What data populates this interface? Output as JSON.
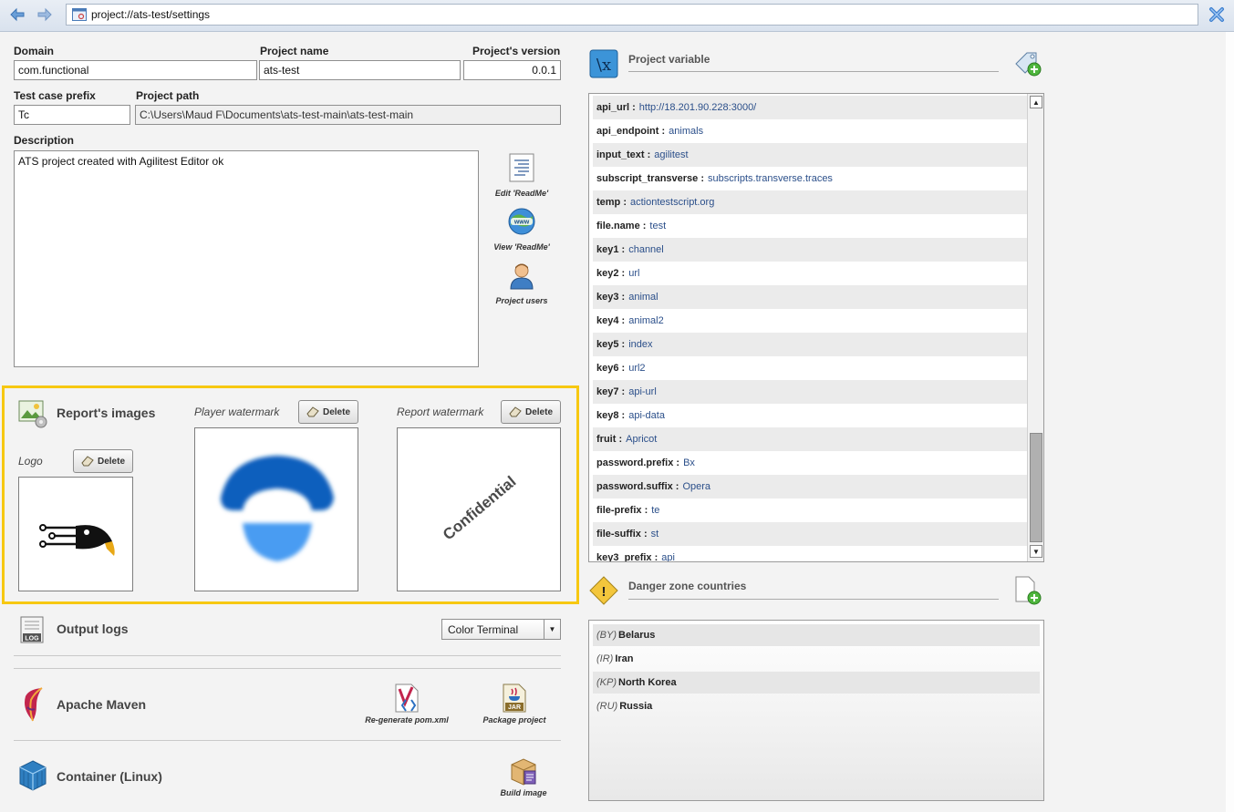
{
  "address_bar": {
    "url": "project://ats-test/settings"
  },
  "project": {
    "domain_label": "Domain",
    "domain_value": "com.functional",
    "name_label": "Project name",
    "name_value": "ats-test",
    "version_label": "Project's version",
    "version_value": "0.0.1",
    "prefix_label": "Test case prefix",
    "prefix_value": "Tc",
    "path_label": "Project path",
    "path_value": "C:\\Users\\Maud F\\Documents\\ats-test-main\\ats-test-main",
    "description_label": "Description",
    "description_value": "ATS project created with Agilitest Editor ok"
  },
  "side_actions": {
    "edit_readme": "Edit 'ReadMe'",
    "view_readme": "View 'ReadMe'",
    "project_users": "Project users"
  },
  "report_images": {
    "title": "Report's images",
    "logo_label": "Logo",
    "player_watermark_label": "Player watermark",
    "report_watermark_label": "Report watermark",
    "delete_label": "Delete",
    "report_watermark_text": "Confidential"
  },
  "output_logs": {
    "title": "Output logs",
    "selected": "Color Terminal"
  },
  "maven": {
    "title": "Apache Maven",
    "regenerate": "Re-generate pom.xml",
    "package": "Package project",
    "jar_text": "JAR"
  },
  "container": {
    "title": "Container (Linux)",
    "build": "Build image"
  },
  "variables": {
    "title": "Project variable",
    "items": [
      {
        "key": "api_url :",
        "value": "http://18.201.90.228:3000/"
      },
      {
        "key": "api_endpoint :",
        "value": "animals"
      },
      {
        "key": "input_text :",
        "value": "agilitest"
      },
      {
        "key": "subscript_transverse :",
        "value": "subscripts.transverse.traces"
      },
      {
        "key": "temp :",
        "value": "actiontestscript.org"
      },
      {
        "key": "file.name :",
        "value": "test"
      },
      {
        "key": "key1 :",
        "value": "channel"
      },
      {
        "key": "key2 :",
        "value": "url"
      },
      {
        "key": "key3 :",
        "value": "animal"
      },
      {
        "key": "key4 :",
        "value": "animal2"
      },
      {
        "key": "key5 :",
        "value": "index"
      },
      {
        "key": "key6 :",
        "value": "url2"
      },
      {
        "key": "key7 :",
        "value": "api-url"
      },
      {
        "key": "key8 :",
        "value": "api-data"
      },
      {
        "key": "fruit :",
        "value": "Apricot"
      },
      {
        "key": "password.prefix :",
        "value": "Bx"
      },
      {
        "key": "password.suffix :",
        "value": "Opera"
      },
      {
        "key": "file-prefix :",
        "value": "te"
      },
      {
        "key": "file-suffix :",
        "value": "st"
      },
      {
        "key": "key3_prefix :",
        "value": "api"
      }
    ]
  },
  "danger_zone": {
    "title": "Danger zone countries",
    "items": [
      {
        "code": "(BY)",
        "name": "Belarus"
      },
      {
        "code": "(IR)",
        "name": "Iran"
      },
      {
        "code": "(KP)",
        "name": "North Korea"
      },
      {
        "code": "(RU)",
        "name": "Russia"
      }
    ]
  },
  "colors": {
    "highlight": "#f7c811",
    "link_value": "#2b4f8a",
    "maven_feather": "#c2254d",
    "container_blue": "#2f7fc1"
  }
}
